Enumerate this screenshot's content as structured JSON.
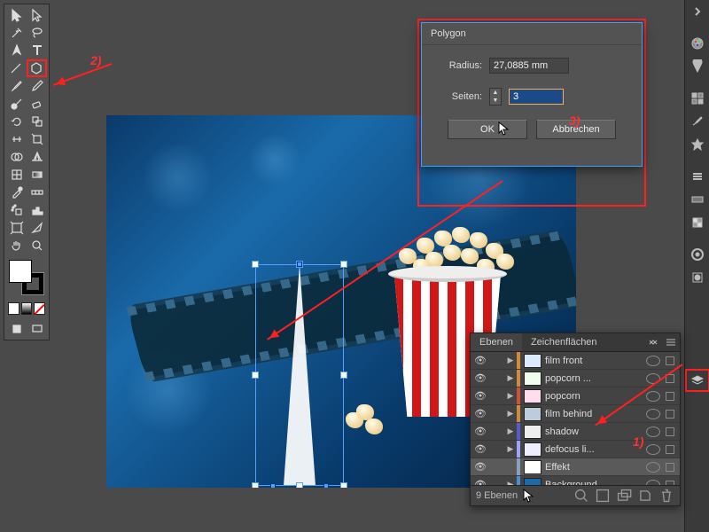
{
  "dialog": {
    "title": "Polygon",
    "radius_label": "Radius:",
    "radius_value": "27,0885 mm",
    "sides_label": "Seiten:",
    "sides_value": "3",
    "ok_label": "OK",
    "cancel_label": "Abbrechen"
  },
  "layers_panel": {
    "tab_layers": "Ebenen",
    "tab_artboards": "Zeichenflächen",
    "rows": [
      {
        "name": "film front",
        "visible": true,
        "expand": "▶",
        "color": "#d08a3a",
        "thumb": "#dceaff"
      },
      {
        "name": "popcorn ...",
        "visible": true,
        "expand": "▶",
        "color": "#d08a3a",
        "thumb": "#efe"
      },
      {
        "name": "popcorn",
        "visible": true,
        "expand": "▶",
        "color": "#d0503a",
        "thumb": "#fde"
      },
      {
        "name": "film behind",
        "visible": true,
        "expand": "▶",
        "color": "#d08a3a",
        "thumb": "#bcd"
      },
      {
        "name": "shadow",
        "visible": true,
        "expand": "▶",
        "color": "#5a5ad0",
        "thumb": "#eee"
      },
      {
        "name": "defocus li...",
        "visible": true,
        "expand": "▶",
        "color": "#a0a0ff",
        "thumb": "#eef"
      },
      {
        "name": "Effekt",
        "visible": true,
        "expand": "",
        "color": "#8aa0c0",
        "thumb": "#ffffff",
        "selected": true
      },
      {
        "name": "Background",
        "visible": true,
        "expand": "▶",
        "color": "#4a90d0",
        "thumb": "#1a6aaa"
      }
    ],
    "footer_count": "9 Ebenen"
  },
  "annotations": {
    "a1": "1)",
    "a2": "2)",
    "a3": "3)"
  },
  "colors": {
    "highlight": "#ff2020"
  }
}
